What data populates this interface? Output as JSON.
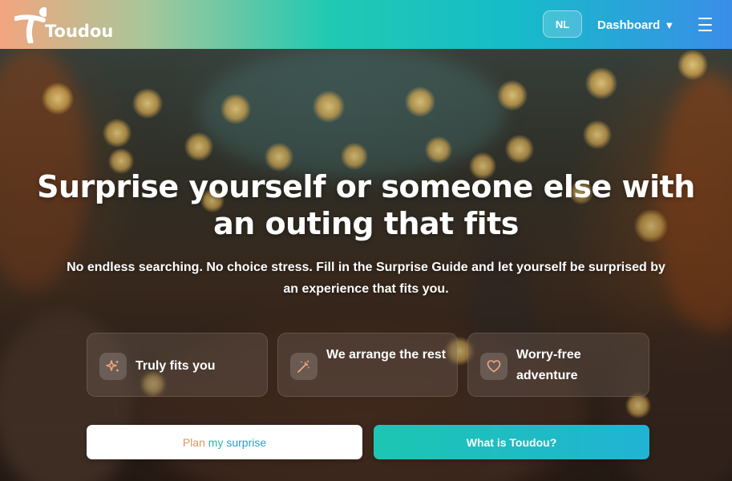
{
  "header": {
    "logo_text": "Toudou",
    "language_label": "NL",
    "dashboard_label": "Dashboard",
    "dashboard_caret": "▼",
    "menu_icon": "hamburger-menu-icon"
  },
  "hero": {
    "title": "Surprise yourself or someone else with an outing that fits",
    "subtitle": "No endless searching. No choice stress. Fill in the Surprise Guide and let yourself be surprised by an experience that fits you."
  },
  "features": [
    {
      "icon": "sparkles-icon",
      "label": "Truly fits you"
    },
    {
      "icon": "magic-wand-icon",
      "label": "We arrange the rest"
    },
    {
      "icon": "heart-icon",
      "label": "Worry-free adventure"
    }
  ],
  "buttons": {
    "plan": {
      "part1": "Plan ",
      "part2": "my ",
      "part3": "surprise"
    },
    "what": "What is Toudou?"
  },
  "colors": {
    "teal": "#1cc6b2",
    "blue": "#2b9fd3",
    "peach": "#e5935e",
    "white": "#ffffff"
  }
}
